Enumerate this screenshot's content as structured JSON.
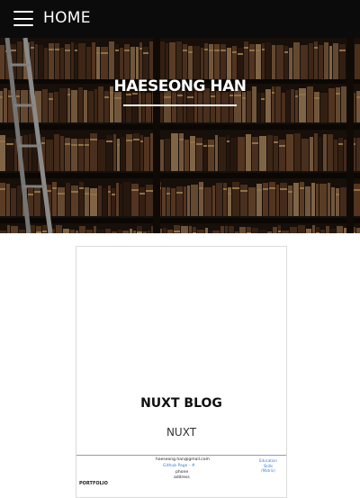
{
  "nav": {
    "title": "HOME",
    "menu_icon": "hamburger-menu-icon",
    "background": "#0b0b0b"
  },
  "hero": {
    "title": "HAESEONG HAN",
    "image": "bookshelf-library-photo"
  },
  "card": {
    "title": "NUXT BLOG",
    "subtitle": "NUXT",
    "preview": {
      "email": "haeseong.han@gmail.com",
      "link": "Github Page - #",
      "phone": "phone",
      "address": "address",
      "section": "PORTFOLIO",
      "right_links": [
        "Education",
        "Skills",
        "(Matrix)"
      ]
    }
  }
}
